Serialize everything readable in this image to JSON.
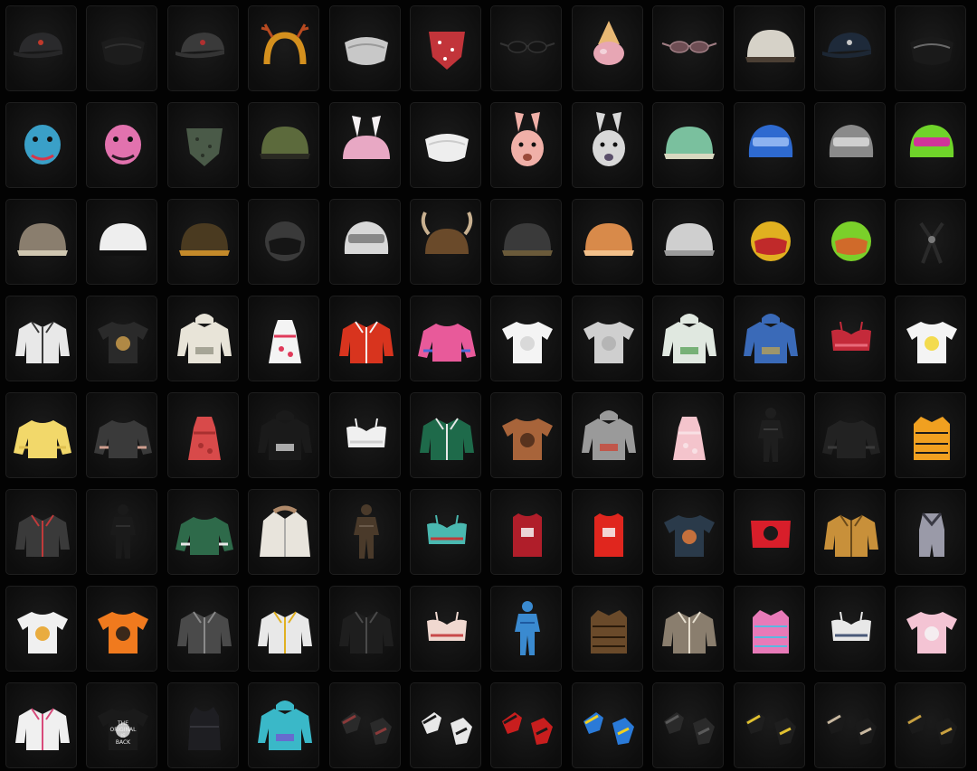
{
  "inventory": {
    "columns": 12,
    "items": [
      {
        "name": "baseball-cap-red-logo",
        "shape": "cap",
        "c1": "#2a2a2c",
        "c2": "#c0392b"
      },
      {
        "name": "black-mask-goggles",
        "shape": "mask",
        "c1": "#1c1c1c",
        "c2": "#2e2e2e"
      },
      {
        "name": "baseball-cap-headset",
        "shape": "cap",
        "c1": "#3a3a3a",
        "c2": "#b03030"
      },
      {
        "name": "reindeer-antler-headband",
        "shape": "headband",
        "c1": "#d4901e",
        "c2": "#b84a20"
      },
      {
        "name": "silver-face-mask",
        "shape": "mask",
        "c1": "#c8c8c8",
        "c2": "#9a9a9a"
      },
      {
        "name": "red-bandana",
        "shape": "bandana",
        "c1": "#c2343a",
        "c2": "#ffffff"
      },
      {
        "name": "black-sunglasses",
        "shape": "glasses",
        "c1": "#151515",
        "c2": "#333333"
      },
      {
        "name": "ice-cream-hat",
        "shape": "icecream",
        "c1": "#e8b874",
        "c2": "#e7a6b4"
      },
      {
        "name": "round-glasses",
        "shape": "glasses",
        "c1": "#6e4e54",
        "c2": "#a07e84"
      },
      {
        "name": "white-fur-hat",
        "shape": "dome",
        "c1": "#d6d2c8",
        "c2": "#4b3f34"
      },
      {
        "name": "navy-cap-headphones",
        "shape": "cap",
        "c1": "#1e2a3a",
        "c2": "#c8c8c8"
      },
      {
        "name": "black-fang-mask",
        "shape": "mask",
        "c1": "#1a1a1a",
        "c2": "#6a6a6a"
      },
      {
        "name": "blue-dinosaur-head",
        "shape": "head",
        "c1": "#3aa0c8",
        "c2": "#d8354a"
      },
      {
        "name": "pink-hippo-head",
        "shape": "head",
        "c1": "#e272ae",
        "c2": "#2a1a24"
      },
      {
        "name": "camo-face-wrap",
        "shape": "bandana",
        "c1": "#4a5a48",
        "c2": "#2a3228"
      },
      {
        "name": "olive-pilot-helmet",
        "shape": "dome",
        "c1": "#5c6a3c",
        "c2": "#2a2a22"
      },
      {
        "name": "pink-bunny-ear-hat",
        "shape": "bunnyhat",
        "c1": "#e8a8c4",
        "c2": "#f4f0f2"
      },
      {
        "name": "white-face-mask",
        "shape": "mask",
        "c1": "#eeeeee",
        "c2": "#cccccc"
      },
      {
        "name": "bunny-head-mask",
        "shape": "bunnyhead",
        "c1": "#f0b0a8",
        "c2": "#9a4a3a"
      },
      {
        "name": "bunny-gas-mask",
        "shape": "bunnyhead",
        "c1": "#d8d8d8",
        "c2": "#5a4f6a"
      },
      {
        "name": "cartoon-helmet",
        "shape": "dome",
        "c1": "#7ac09e",
        "c2": "#d8d8c0"
      },
      {
        "name": "blue-knight-helmet",
        "shape": "visorhelm",
        "c1": "#2e6ad0",
        "c2": "#8cb2f0"
      },
      {
        "name": "level-3-spetsnaz-helmet",
        "shape": "visorhelm",
        "c1": "#8a8a8a",
        "c2": "#cfcfcf"
      },
      {
        "name": "green-neon-helmet",
        "shape": "visorhelm",
        "c1": "#6fd42a",
        "c2": "#d0349a"
      },
      {
        "name": "army-helmet-stickers",
        "shape": "dome",
        "c1": "#8a7e6e",
        "c2": "#cfc6b0"
      },
      {
        "name": "panda-helmet",
        "shape": "dome",
        "c1": "#eeeeee",
        "c2": "#111111"
      },
      {
        "name": "camo-combat-helmet",
        "shape": "dome",
        "c1": "#4a3a20",
        "c2": "#c48a2a"
      },
      {
        "name": "black-motorcycle-helmet",
        "shape": "moto",
        "c1": "#3a3a3a",
        "c2": "#151515"
      },
      {
        "name": "white-spetsnaz-helmet",
        "shape": "visorhelm",
        "c1": "#d8d8d8",
        "c2": "#888888"
      },
      {
        "name": "viking-horn-helmet",
        "shape": "horns",
        "c1": "#6a4a2a",
        "c2": "#c8b090"
      },
      {
        "name": "dark-combat-helmet",
        "shape": "dome",
        "c1": "#3a3a3a",
        "c2": "#6a5a3a"
      },
      {
        "name": "orange-beanie",
        "shape": "dome",
        "c1": "#d88a4a",
        "c2": "#f2c08a"
      },
      {
        "name": "graffiti-helmet",
        "shape": "dome",
        "c1": "#cfcfcf",
        "c2": "#9a9a9a"
      },
      {
        "name": "tiger-racing-helmet",
        "shape": "moto",
        "c1": "#e0b020",
        "c2": "#c02a2a"
      },
      {
        "name": "green-racing-helmet",
        "shape": "moto",
        "c1": "#7ad02a",
        "c2": "#d06a2a"
      },
      {
        "name": "black-harness",
        "shape": "harness",
        "c1": "#2a2a2a",
        "c2": "#7a7a7a"
      },
      {
        "name": "white-cropped-jacket",
        "shape": "jacket",
        "c1": "#e8e8e8",
        "c2": "#3a3a3a"
      },
      {
        "name": "black-graphic-tee",
        "shape": "tee",
        "c1": "#2a2a2a",
        "c2": "#c89a4a"
      },
      {
        "name": "cream-hoodie",
        "shape": "hoodie",
        "c1": "#e8e4d8",
        "c2": "#8a8a7a"
      },
      {
        "name": "graffiti-dress-hoodie",
        "shape": "dress",
        "c1": "#f4f4f4",
        "c2": "#e03a5a"
      },
      {
        "name": "red-varsity-jacket",
        "shape": "jacket",
        "c1": "#d8341e",
        "c2": "#f4f4f4"
      },
      {
        "name": "pink-blue-crop-top",
        "shape": "sweater",
        "c1": "#e85a9a",
        "c2": "#4a6ad8"
      },
      {
        "name": "white-tee",
        "shape": "tee",
        "c1": "#f4f4f4",
        "c2": "#d4d4d4"
      },
      {
        "name": "grey-tee",
        "shape": "tee",
        "c1": "#cfcfcf",
        "c2": "#b0b0b0"
      },
      {
        "name": "plant-print-hoodie",
        "shape": "hoodie",
        "c1": "#e0e8e0",
        "c2": "#4a9a4a"
      },
      {
        "name": "blue-rain-jacket",
        "shape": "hoodie",
        "c1": "#3a6ab8",
        "c2": "#c8a84a"
      },
      {
        "name": "red-sports-bra",
        "shape": "bra",
        "c1": "#c42a3a",
        "c2": "#e86a7a"
      },
      {
        "name": "yellow-emoji-tee",
        "shape": "tee",
        "c1": "#f4f4f4",
        "c2": "#f2d630"
      },
      {
        "name": "yellow-fuzzy-sweater",
        "shape": "sweater",
        "c1": "#f2d86a",
        "c2": "#e0c050"
      },
      {
        "name": "tattoo-sleeve-tee",
        "shape": "sweater",
        "c1": "#3a3a3a",
        "c2": "#d0a090"
      },
      {
        "name": "red-mini-dress",
        "shape": "dress",
        "c1": "#d84a4a",
        "c2": "#a83030"
      },
      {
        "name": "black-white-hoodie",
        "shape": "hoodie",
        "c1": "#1a1a1a",
        "c2": "#e8e8e8"
      },
      {
        "name": "white-sports-bra",
        "shape": "bra",
        "c1": "#f0f0f0",
        "c2": "#cfcfcf"
      },
      {
        "name": "green-varsity-jacket",
        "shape": "jacket",
        "c1": "#1e6a4a",
        "c2": "#e8e8e8"
      },
      {
        "name": "leopard-shirt",
        "shape": "tee",
        "c1": "#a8643a",
        "c2": "#4a2a1a"
      },
      {
        "name": "grey-red-hooded-jacket",
        "shape": "hoodie",
        "c1": "#9a9a9a",
        "c2": "#d03a2a"
      },
      {
        "name": "pink-bunny-outfit",
        "shape": "dress",
        "c1": "#f4c4cc",
        "c2": "#f8e0e4"
      },
      {
        "name": "black-bodysuit",
        "shape": "suit",
        "c1": "#1e1e1e",
        "c2": "#3a3a3a"
      },
      {
        "name": "black-long-sleeve",
        "shape": "sweater",
        "c1": "#222222",
        "c2": "#3a3a3a"
      },
      {
        "name": "orange-puffer-vest",
        "shape": "vest",
        "c1": "#f0a020",
        "c2": "#1a1a1a"
      },
      {
        "name": "tactical-armored-jacket",
        "shape": "jacket",
        "c1": "#3a3a3a",
        "c2": "#c03a3a"
      },
      {
        "name": "black-tactical-suit",
        "shape": "suit",
        "c1": "#1a1a1a",
        "c2": "#2e2e2e"
      },
      {
        "name": "green-floral-sweater",
        "shape": "sweater",
        "c1": "#2e6a4a",
        "c2": "#e8e8e8"
      },
      {
        "name": "white-parka-fur",
        "shape": "coat",
        "c1": "#e8e4dc",
        "c2": "#b08a6a"
      },
      {
        "name": "brown-field-outfit",
        "shape": "suit",
        "c1": "#4a3a2a",
        "c2": "#6a5a4a"
      },
      {
        "name": "teal-graphic-bra",
        "shape": "bra",
        "c1": "#4ab8b0",
        "c2": "#c03a3a"
      },
      {
        "name": "red-jersey-21",
        "shape": "jersey",
        "c1": "#b01e2a",
        "c2": "#f4f4f4"
      },
      {
        "name": "red-jersey-23",
        "shape": "jersey",
        "c1": "#e0261e",
        "c2": "#f4f4f4"
      },
      {
        "name": "land-lost-tee",
        "shape": "tee",
        "c1": "#2a3a4a",
        "c2": "#e07a3a"
      },
      {
        "name": "red-cat-tube-top",
        "shape": "tube",
        "c1": "#d81e2a",
        "c2": "#1a1a1a"
      },
      {
        "name": "tan-leather-jacket",
        "shape": "jacket",
        "c1": "#c8903a",
        "c2": "#6a4a1a"
      },
      {
        "name": "grey-romper",
        "shape": "romper",
        "c1": "#9a9aa8",
        "c2": "#3a3a44"
      },
      {
        "name": "white-graphic-tee",
        "shape": "tee",
        "c1": "#f0f0f0",
        "c2": "#e8a020"
      },
      {
        "name": "orange-tiger-tee",
        "shape": "tee",
        "c1": "#f07a1e",
        "c2": "#1a1a1a"
      },
      {
        "name": "grey-armor-jacket",
        "shape": "jacket",
        "c1": "#4a4a4a",
        "c2": "#8a8a8a"
      },
      {
        "name": "yellow-black-jacket",
        "shape": "jacket",
        "c1": "#e8e8e8",
        "c2": "#e0b020"
      },
      {
        "name": "black-leather-jacket",
        "shape": "jacket",
        "c1": "#1e1e1e",
        "c2": "#4a4a4a"
      },
      {
        "name": "floral-bralette",
        "shape": "bra",
        "c1": "#f0d8d0",
        "c2": "#c84a4a"
      },
      {
        "name": "blue-onesie",
        "shape": "suit",
        "c1": "#3a8ad0",
        "c2": "#1e5aa0"
      },
      {
        "name": "leopard-halter-top",
        "shape": "vest",
        "c1": "#6a4a2a",
        "c2": "#2a1a0a"
      },
      {
        "name": "camo-fur-jacket",
        "shape": "jacket",
        "c1": "#8a7e6e",
        "c2": "#e8e0d0"
      },
      {
        "name": "pink-puffer-vest",
        "shape": "vest",
        "c1": "#e87ab8",
        "c2": "#5ab8e0"
      },
      {
        "name": "white-crop-top",
        "shape": "bra",
        "c1": "#e8e8e8",
        "c2": "#4a5a7a"
      },
      {
        "name": "pink-tie-shirt",
        "shape": "tee",
        "c1": "#f4c4d4",
        "c2": "#f4f4f4"
      },
      {
        "name": "white-graffiti-jacket",
        "shape": "jacket",
        "c1": "#f0f0f0",
        "c2": "#d84a7a"
      },
      {
        "name": "og-original-tee",
        "shape": "tee",
        "c1": "#1a1a1a",
        "c2": "#e8e8e8",
        "text": [
          "THE",
          "ORIGINAL",
          "IS",
          "BACK"
        ]
      },
      {
        "name": "black-tank-top",
        "shape": "tank",
        "c1": "#1e1e22",
        "c2": "#34343a"
      },
      {
        "name": "teal-purple-hoodie",
        "shape": "hoodie",
        "c1": "#3ab8c8",
        "c2": "#7a4ad0"
      },
      {
        "name": "black-gloves",
        "shape": "gloves",
        "c1": "#2a2a2a",
        "c2": "#8a3a3a"
      },
      {
        "name": "white-black-gloves",
        "shape": "gloves",
        "c1": "#e8e8e8",
        "c2": "#1a1a1a"
      },
      {
        "name": "red-racing-gloves",
        "shape": "gloves",
        "c1": "#c81e1e",
        "c2": "#1a1a1a"
      },
      {
        "name": "blue-yellow-gloves",
        "shape": "gloves",
        "c1": "#2a7ad8",
        "c2": "#f0d020"
      },
      {
        "name": "tactical-gloves",
        "shape": "gloves",
        "c1": "#2a2a2a",
        "c2": "#5a5a5a"
      },
      {
        "name": "black-yellow-gloves",
        "shape": "gloves",
        "c1": "#1e1e1e",
        "c2": "#e0c030"
      },
      {
        "name": "skeleton-gloves",
        "shape": "gloves",
        "c1": "#1a1a1a",
        "c2": "#c8b8a0"
      },
      {
        "name": "gold-black-gloves",
        "shape": "gloves",
        "c1": "#1a1a1a",
        "c2": "#c8a040"
      }
    ]
  }
}
